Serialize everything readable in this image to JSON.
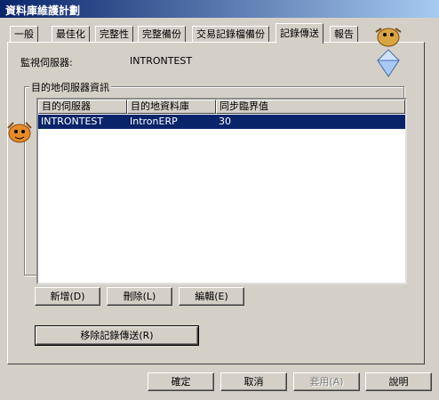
{
  "window": {
    "title": "資料庫維護計劃"
  },
  "tabs": [
    {
      "label": "一般"
    },
    {
      "label": "最佳化"
    },
    {
      "label": "完整性"
    },
    {
      "label": "完整備份"
    },
    {
      "label": "交易記錄檔備份"
    },
    {
      "label": "記錄傳送",
      "active": true
    },
    {
      "label": "報告"
    }
  ],
  "monitor": {
    "label": "監視伺服器:",
    "value": "INTRONTEST"
  },
  "destination": {
    "group_title": "目的地伺服器資訊",
    "columns": [
      "目的伺服器",
      "目的地資料庫",
      "同步臨界值"
    ],
    "rows": [
      [
        "INTRONTEST",
        "IntronERP",
        "30"
      ]
    ],
    "buttons": {
      "add": "新增(D)",
      "delete": "刪除(L)",
      "edit": "編輯(E)"
    }
  },
  "remove_button": "移除記錄傳送(R)",
  "footer": {
    "ok": "確定",
    "cancel": "取消",
    "apply": "套用(A)",
    "help": "說明"
  }
}
